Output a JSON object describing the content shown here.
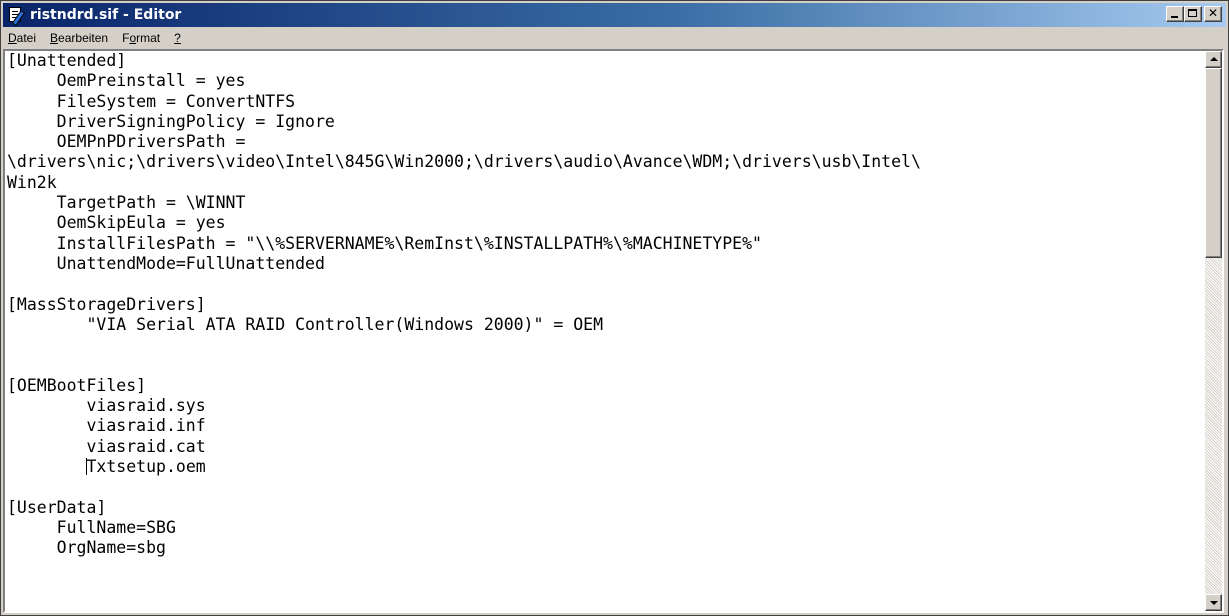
{
  "window": {
    "title": "ristndrd.sif - Editor",
    "icon": "notepad-icon",
    "controls": {
      "minimize_icon": "minimize-icon",
      "maximize_icon": "maximize-icon",
      "close_label": "✕"
    }
  },
  "menu": [
    {
      "label": "Datei",
      "accel": "D"
    },
    {
      "label": "Bearbeiten",
      "accel": "B"
    },
    {
      "label": "Format",
      "accel": "o"
    },
    {
      "label": "?",
      "accel": "?"
    }
  ],
  "editor": {
    "lines": [
      "[Unattended]",
      "     OemPreinstall = yes",
      "     FileSystem = ConvertNTFS",
      "     DriverSigningPolicy = Ignore",
      "     OEMPnPDriversPath =",
      "\\drivers\\nic;\\drivers\\video\\Intel\\845G\\Win2000;\\drivers\\audio\\Avance\\WDM;\\drivers\\usb\\Intel\\",
      "Win2k",
      "     TargetPath = \\WINNT",
      "     OemSkipEula = yes",
      "     InstallFilesPath = \"\\\\%SERVERNAME%\\RemInst\\%INSTALLPATH%\\%MACHINETYPE%\"",
      "     UnattendMode=FullUnattended",
      "",
      "[MassStorageDrivers]",
      "        \"VIA Serial ATA RAID Controller(Windows 2000)\" = OEM",
      "",
      "",
      "[OEMBootFiles]",
      "        viasraid.sys",
      "        viasraid.inf",
      "        viasraid.cat",
      "        Txtsetup.oem",
      "",
      "[UserData]",
      "     FullName=SBG",
      "     OrgName=sbg"
    ],
    "caret_line": 20,
    "caret_col": 8
  },
  "scrollbar": {
    "up_icon": "scroll-up-arrow-icon",
    "down_icon": "scroll-down-arrow-icon",
    "position": 0
  }
}
